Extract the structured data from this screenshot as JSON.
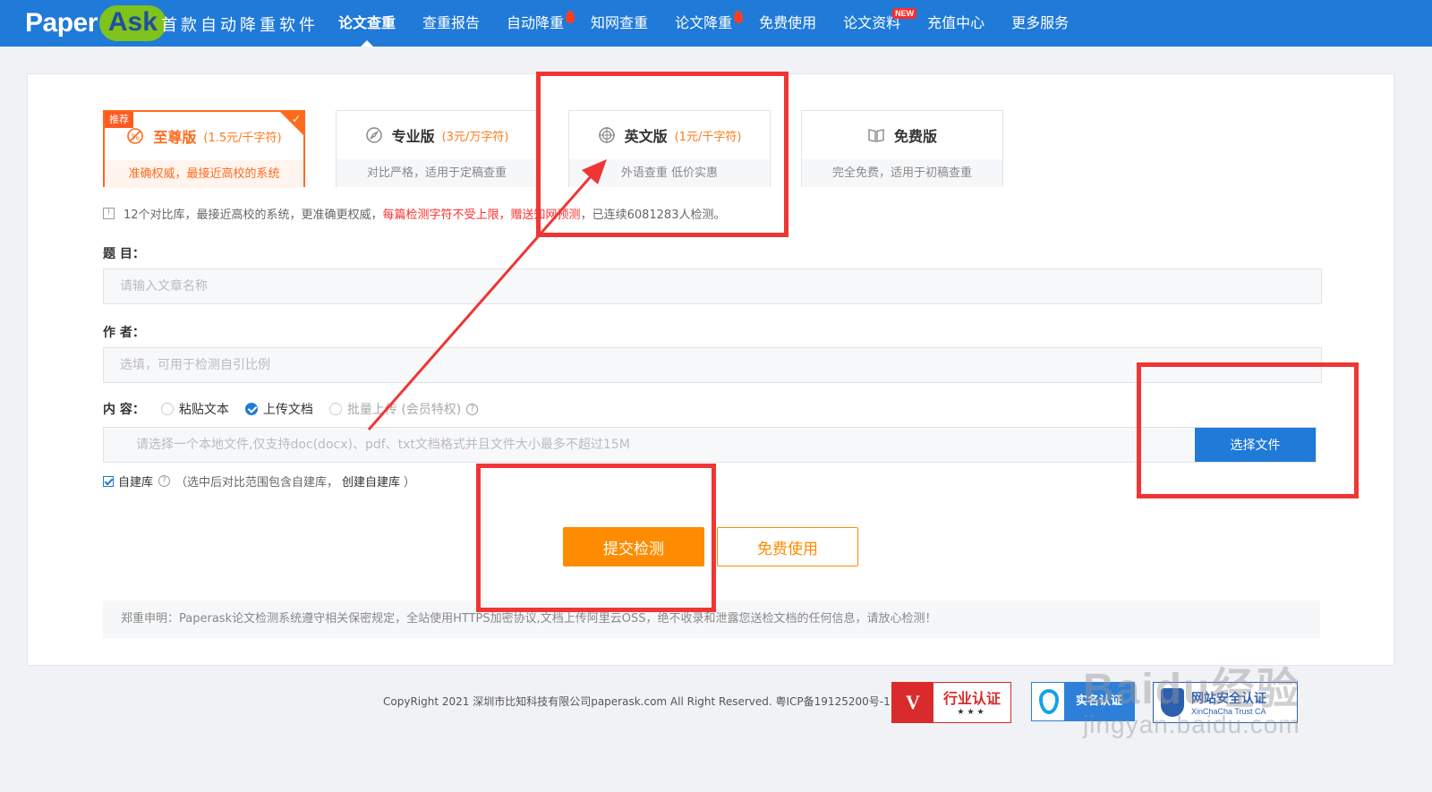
{
  "logo": {
    "paper": "Paper",
    "ask": "Ask"
  },
  "slogan": "首款自动降重软件",
  "nav": [
    {
      "label": "论文查重",
      "active": true
    },
    {
      "label": "查重报告"
    },
    {
      "label": "自动降重",
      "hot": true
    },
    {
      "label": "知网查重"
    },
    {
      "label": "论文降重",
      "hot": true
    },
    {
      "label": "免费使用"
    },
    {
      "label": "论文资料",
      "new": "NEW"
    },
    {
      "label": "充值中心"
    },
    {
      "label": "更多服务"
    }
  ],
  "plans": [
    {
      "tag": "推荐",
      "name": "至尊版",
      "price": "(1.5元/千字符)",
      "desc": "准确权威，最接近高校的系统",
      "icon": "no-copy-icon"
    },
    {
      "name": "专业版",
      "price": "(3元/万字符)",
      "desc": "对比严格，适用于定稿查重",
      "icon": "compass-icon"
    },
    {
      "name": "英文版",
      "price": "(1元/千字符)",
      "desc": "外语查重 低价实惠",
      "icon": "target-icon"
    },
    {
      "name": "免费版",
      "price": "",
      "desc": "完全免费，适用于初稿查重",
      "icon": "book-icon"
    }
  ],
  "notice": {
    "icon": "!",
    "part1": "12个对比库，最接近高校的系统，更准确更权威，",
    "part2": "每篇检测字符不受上限，赠送知网预测",
    "part3": "，已连续6081283人检测。"
  },
  "form": {
    "title_label": "题 目：",
    "title_placeholder": "请输入文章名称",
    "author_label": "作 者：",
    "author_placeholder": "选填，可用于检测自引比例",
    "content_label": "内 容：",
    "options": [
      "粘贴文本",
      "上传文档",
      "批量上传 (会员特权)"
    ],
    "help": "?",
    "file_placeholder": "请选择一个本地文件,仅支持doc(docx)、pdf、txt文档格式并且文件大小最多不超过15M",
    "file_button": "选择文件",
    "self_label": "自建库",
    "self_note": "（选中后对比范围包含自建库，",
    "self_create": "创建自建库",
    "self_close": "）",
    "submit": "提交检测",
    "free": "免费使用"
  },
  "statement": "郑重申明：Paperask论文检测系统遵守相关保密规定，全站使用HTTPS加密协议,文档上传阿里云OSS，绝不收录和泄露您送检文档的任何信息，请放心检测！",
  "footer": {
    "copyright": "CopyRight 2021 深圳市比知科技有限公司paperask.com All Right Reserved. 粤ICP备19125200号-1",
    "badge_industry_mark": "V",
    "badge_industry": "行业认证",
    "badge_industry_stars": "★★★",
    "badge_realname": "实名认证",
    "badge_trust": "网站安全认证",
    "badge_trust_sub": "XinChaCha Trust CA"
  },
  "watermark": {
    "main": "Baidu经验",
    "sub": "jingyan.baidu.com"
  },
  "colors": {
    "nav": "#1f7ad8",
    "accent": "#ff8c00",
    "annotation": "#f03535"
  }
}
